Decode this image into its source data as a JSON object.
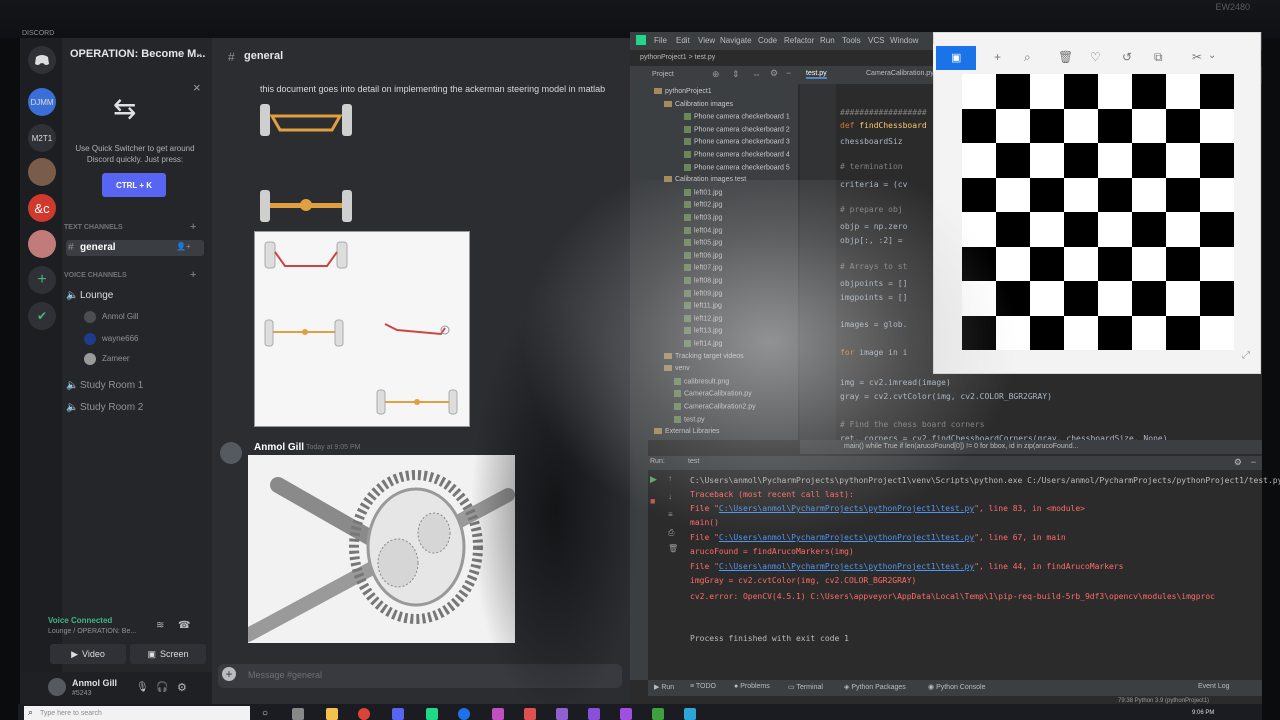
{
  "monitor": {
    "brand": "EW2480"
  },
  "discord": {
    "app_title": "DISCORD",
    "server_name": "OPERATION: Become M...",
    "guilds": [
      "DJMM",
      "M2T1",
      "&c"
    ],
    "quick_switcher": {
      "text": "Use Quick Switcher to get around Discord quickly. Just press:",
      "shortcut": "CTRL + K"
    },
    "categories": {
      "text": "TEXT CHANNELS",
      "voice": "VOICE CHANNELS"
    },
    "text_channels": [
      "general"
    ],
    "voice_channels": [
      "Lounge",
      "Study Room 1",
      "Study Room 2"
    ],
    "lounge_users": [
      "Anmol Gill",
      "wayne666",
      "Zameer"
    ],
    "voice_status": "Voice Connected",
    "voice_location": "Lounge / OPERATION: Be...",
    "video_label": "Video",
    "screen_label": "Screen",
    "user": {
      "name": "Anmol Gill",
      "tag": "#5243"
    },
    "chat": {
      "channel": "general",
      "message_text": "this document goes into detail on implementing the ackerman steering model in matlab",
      "author": "Anmol Gill",
      "timestamp": "Today at 9:05 PM",
      "input_placeholder": "Message #general"
    }
  },
  "pycharm": {
    "menu": [
      "File",
      "Edit",
      "View",
      "Navigate",
      "Code",
      "Refactor",
      "Run",
      "Tools",
      "VCS",
      "Window"
    ],
    "project_crumb": "pythonProject1  >  test.py",
    "tabs": [
      "test.py",
      "CameraCalibration.py"
    ],
    "project_label": "Project",
    "tree": [
      "pythonProject1",
      "Calibration images",
      "Phone camera checkerboard 1",
      "Phone camera checkerboard 2",
      "Phone camera checkerboard 3",
      "Phone camera checkerboard 4",
      "Phone camera checkerboard 5",
      "Calibration images test",
      "left01.jpg",
      "left02.jpg",
      "left03.jpg",
      "left04.jpg",
      "left05.jpg",
      "left06.jpg",
      "left07.jpg",
      "left08.jpg",
      "left09.jpg",
      "left11.jpg",
      "left12.jpg",
      "left13.jpg",
      "left14.jpg",
      "Tracking target videos",
      "venv",
      "calibresult.png",
      "CameraCalibration.py",
      "CameraCalibration2.py",
      "test.py",
      "External Libraries"
    ],
    "code": [
      "##################",
      "def findChessboard",
      "    chessboardSiz",
      "    # termination",
      "    criteria = (cv",
      "    # prepare obj",
      "    objp = np.zero",
      "    objp[:, :2] =",
      "    # Arrays to st",
      "    objpoints = []",
      "    imgpoints = []",
      "    images = glob.",
      "    for image in i",
      "        img = cv2.imread(image)",
      "        gray = cv2.cvtColor(img, cv2.COLOR_BGR2GRAY)",
      "        # Find the chess board corners",
      "        ret, corners = cv2.findChessboardCorners(gray, chessboardSize, None)"
    ],
    "editor_crumbs": "main()   while True   if len(arucoFound[0]) != 0   for bbox, id in zip(arucoFound...",
    "run_label": "Run:",
    "run_config": "test",
    "output": [
      {
        "type": "normal",
        "text": "C:\\Users\\anmol\\PycharmProjects\\pythonProject1\\venv\\Scripts\\python.exe C:/Users/anmol/PycharmProjects/pythonProject1/test.py"
      },
      {
        "type": "err",
        "text": "Traceback (most recent call last):"
      },
      {
        "type": "err",
        "text": "  File \"",
        "link": "C:\\Users\\anmol\\PycharmProjects\\pythonProject1\\test.py",
        "rest": "\", line 83, in <module>"
      },
      {
        "type": "err",
        "text": "    main()"
      },
      {
        "type": "err",
        "text": "  File \"",
        "link": "C:\\Users\\anmol\\PycharmProjects\\pythonProject1\\test.py",
        "rest": "\", line 67, in main"
      },
      {
        "type": "err",
        "text": "    arucoFound = findArucoMarkers(img)"
      },
      {
        "type": "err",
        "text": "  File \"",
        "link": "C:\\Users\\anmol\\PycharmProjects\\pythonProject1\\test.py",
        "rest": "\", line 44, in findArucoMarkers"
      },
      {
        "type": "err",
        "text": "    imgGray = cv2.cvtColor(img, cv2.COLOR_BGR2GRAY)"
      },
      {
        "type": "err",
        "text": "cv2.error: OpenCV(4.5.1) C:\\Users\\appveyor\\AppData\\Local\\Temp\\1\\pip-req-build-5rb_9df3\\opencv\\modules\\imgproc"
      },
      {
        "type": "normal",
        "text": ""
      },
      {
        "type": "normal",
        "text": "Process finished with exit code 1"
      }
    ],
    "bottom_tabs": [
      "Run",
      "TODO",
      "Problems",
      "Terminal",
      "Python Packages",
      "Python Console"
    ],
    "event_log": "Event Log",
    "status": "79:38   Python 3.9 (pythonProject1)"
  },
  "viewer": {
    "icons": [
      "save-icon",
      "plus-icon",
      "zoom-icon",
      "delete-icon",
      "heart-icon",
      "rotate-icon",
      "crop-icon",
      "tools-icon"
    ]
  },
  "taskbar": {
    "search_placeholder": "Type here to search",
    "clock": "9:06 PM"
  },
  "colors": {
    "discord_blurple": "#5865f2",
    "voice_green": "#43b581",
    "error_red": "#ff6b68",
    "link_blue": "#5394ec",
    "viewer_accent": "#1a73e8"
  }
}
